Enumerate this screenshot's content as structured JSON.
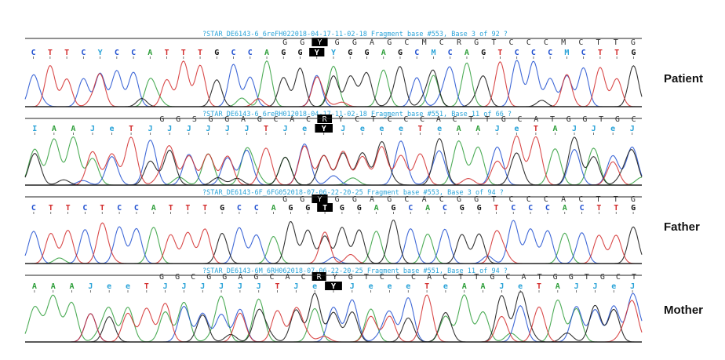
{
  "colors": {
    "A": "#2e9e3a",
    "C": "#1f4fd0",
    "G": "#111111",
    "T": "#d22a2a",
    "ambiguous": "#2aa3d8",
    "header": "#2aa3d8",
    "highlight_bg": "#000000",
    "highlight_fg": "#ffffff",
    "axis": "#222222"
  },
  "labels": {
    "patient": "Patient",
    "father": "Father",
    "mother": "Mother"
  },
  "panels": [
    {
      "header": "?STAR_DE6143-6_6reFH022018-04-17-11-02-18 Fragment base #553, Base 3 of 92 ?",
      "ref_seq": "GG?GGAGCMCRGTCCCMCTTG",
      "ref_highlight": 2,
      "call_seq": "CTTCYCCATTTGCCAGG?YGGAGCMCAGTCCCMCTTG",
      "call_highlight": 17,
      "trace_seed": 11,
      "trace_variant": "patient-fwd"
    },
    {
      "header": "?STAR_DE6143-6_6reRH012018-04-17-11-02-18 Fragment base #551, Base 11 of 66 ?",
      "ref_seq": "GGSGGAGCACR?CTCCCACTTGCATGGTGC",
      "ref_highlight": 10,
      "call_seq": "IAAJeTJJJJJJTJeYJeeeTeAAJeTAJJeJ",
      "call_highlight": 15,
      "trace_seed": 23,
      "trace_variant": "patient-rev"
    },
    {
      "header": "?STAR_DE6143-6F_6FG052018-07-06-22-20-25 Fragment base #553, Base 3 of 94 ?",
      "ref_seq": "GG?GGAGCACGGTCCCACTTG",
      "ref_highlight": 2,
      "call_seq": "CTTCTCCATTTGCCAGGTGGAGCACGGTCCCACTTG",
      "call_highlight": 17,
      "trace_seed": 37,
      "trace_variant": "father"
    },
    {
      "header": "?STAR_DE6143-6M_6RH062018-07-06-22-20-25 Fragment base #551, Base 11 of 94 ?",
      "ref_seq": "GGCGGAGCACR?GTCCCACTTGCATGGTGCT",
      "ref_highlight": 10,
      "call_seq": "AAAJeeTJJJJJJTJeYJeeeTeAAJeTAJJeJ",
      "call_highlight": 16,
      "trace_seed": 53,
      "trace_variant": "mother"
    }
  ]
}
